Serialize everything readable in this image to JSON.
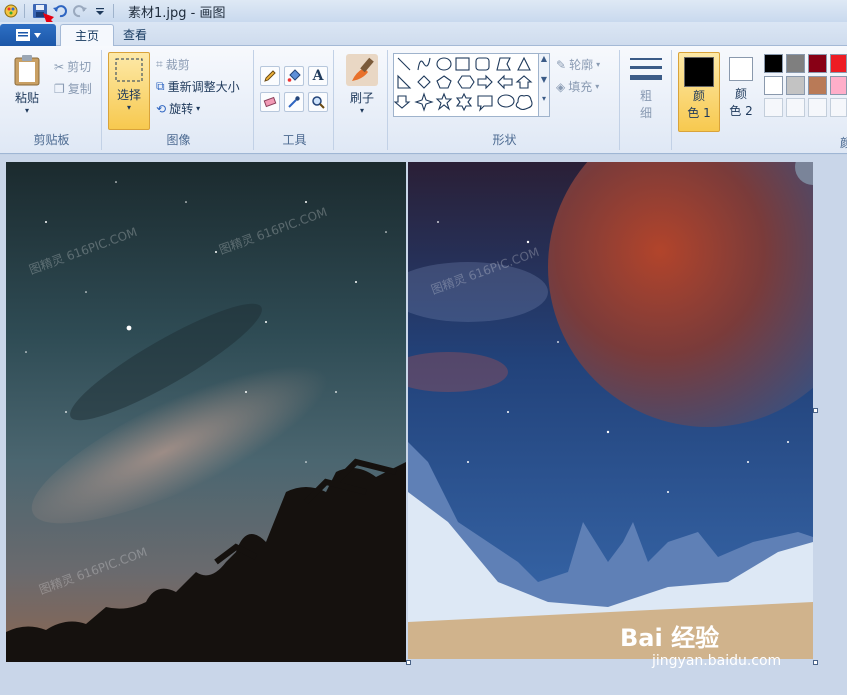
{
  "window": {
    "title": "素材1.jpg - 画图"
  },
  "tabs": [
    {
      "label": "主页"
    },
    {
      "label": "查看"
    }
  ],
  "clipboard": {
    "paste": "粘贴",
    "cut": "剪切",
    "copy": "复制",
    "group": "剪贴板"
  },
  "image": {
    "select": "选择",
    "crop": "裁剪",
    "resize": "重新调整大小",
    "rotate": "旋转",
    "group": "图像"
  },
  "tools": {
    "group": "工具"
  },
  "brushes": {
    "label": "刷子"
  },
  "shapes": {
    "group": "形状",
    "outline": "轮廓",
    "fill": "填充"
  },
  "size": {
    "label_1": "粗",
    "label_2": "细"
  },
  "colors": {
    "color1_a": "颜",
    "color1_b": "色 1",
    "color2_a": "颜",
    "color2_b": "色 2",
    "group_cut": "颜",
    "palette_row1": [
      "#000000",
      "#7f7f7f",
      "#880015",
      "#ed1c24"
    ],
    "palette_row2": [
      "#ffffff",
      "#c3c3c3",
      "#b97a57",
      "#ffaec9"
    ]
  },
  "canvas": {
    "watermark": "图精灵 616PIC.COM",
    "logo": "Bai 经验",
    "logo_url": "jingyan.baidu.com"
  },
  "accent": {
    "app_blue": "#1c57a8",
    "selected": "#fbd77a",
    "annotation_red": "#e60012"
  }
}
